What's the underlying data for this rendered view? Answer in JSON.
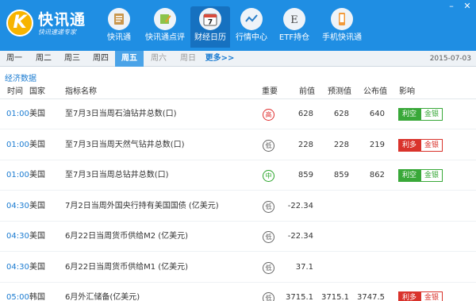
{
  "app": {
    "name": "快讯通",
    "slogan": "快讯速递专家"
  },
  "nav": [
    {
      "label": "快讯通",
      "icon": "news-scroll-icon"
    },
    {
      "label": "快讯通点评",
      "icon": "pen-edit-icon"
    },
    {
      "label": "财经日历",
      "icon": "calendar-icon",
      "badge": "7",
      "active": true
    },
    {
      "label": "行情中心",
      "icon": "chart-line-icon"
    },
    {
      "label": "ETF持仓",
      "icon": "etf-letter-icon",
      "badge": "E"
    },
    {
      "label": "手机快讯通",
      "icon": "mobile-phone-icon"
    }
  ],
  "window_controls": {
    "minimize": "–",
    "close": "✕"
  },
  "days": [
    {
      "label": "周一",
      "state": "normal"
    },
    {
      "label": "周二",
      "state": "normal"
    },
    {
      "label": "周三",
      "state": "normal"
    },
    {
      "label": "周四",
      "state": "normal"
    },
    {
      "label": "周五",
      "state": "active"
    },
    {
      "label": "周六",
      "state": "dim"
    },
    {
      "label": "周日",
      "state": "dim"
    },
    {
      "label": "更多>>",
      "state": "more"
    }
  ],
  "date": "2015-07-03",
  "section_title": "经济数据",
  "columns": {
    "time": "时间",
    "country": "国家",
    "indicator": "指标名称",
    "importance": "重要",
    "previous": "前值",
    "forecast": "预测值",
    "actual": "公布值",
    "impact": "影响"
  },
  "rows": [
    {
      "time": "01:00",
      "country": "美国",
      "indicator": "至7月3日当周石油钻井总数(口)",
      "importance": "高",
      "level": "high",
      "previous": "628",
      "forecast": "628",
      "actual": "640",
      "impact": [
        {
          "text": "利空",
          "style": "green"
        },
        {
          "text": "金银",
          "style": "outline-green"
        }
      ]
    },
    {
      "time": "01:00",
      "country": "美国",
      "indicator": "至7月3日当周天然气钻井总数(口)",
      "importance": "低",
      "level": "low",
      "previous": "228",
      "forecast": "228",
      "actual": "219",
      "impact": [
        {
          "text": "利多",
          "style": "red"
        },
        {
          "text": "金银",
          "style": "outline-red"
        }
      ]
    },
    {
      "time": "01:00",
      "country": "美国",
      "indicator": "至7月3日当周总钻井总数(口)",
      "importance": "中",
      "level": "mid",
      "previous": "859",
      "forecast": "859",
      "actual": "862",
      "impact": [
        {
          "text": "利空",
          "style": "green"
        },
        {
          "text": "金银",
          "style": "outline-green"
        }
      ]
    },
    {
      "time": "04:30",
      "country": "美国",
      "indicator": "7月2日当周外国央行持有美国国债 (亿美元)",
      "importance": "低",
      "level": "low",
      "previous": "-22.34",
      "forecast": "",
      "actual": "",
      "impact": []
    },
    {
      "time": "04:30",
      "country": "美国",
      "indicator": "6月22日当周货币供给M2 (亿美元)",
      "importance": "低",
      "level": "low",
      "previous": "-22.34",
      "forecast": "",
      "actual": "",
      "impact": []
    },
    {
      "time": "04:30",
      "country": "美国",
      "indicator": "6月22日当周货币供给M1 (亿美元)",
      "importance": "低",
      "level": "low",
      "previous": "37.1",
      "forecast": "",
      "actual": "",
      "impact": []
    },
    {
      "time": "05:00",
      "country": "韩国",
      "indicator": "6月外汇储备(亿美元)",
      "importance": "低",
      "level": "low",
      "previous": "3715.1",
      "forecast": "3715.1",
      "actual": "3747.5",
      "impact": [
        {
          "text": "利多",
          "style": "red"
        },
        {
          "text": "金银",
          "style": "outline-red"
        }
      ]
    }
  ]
}
